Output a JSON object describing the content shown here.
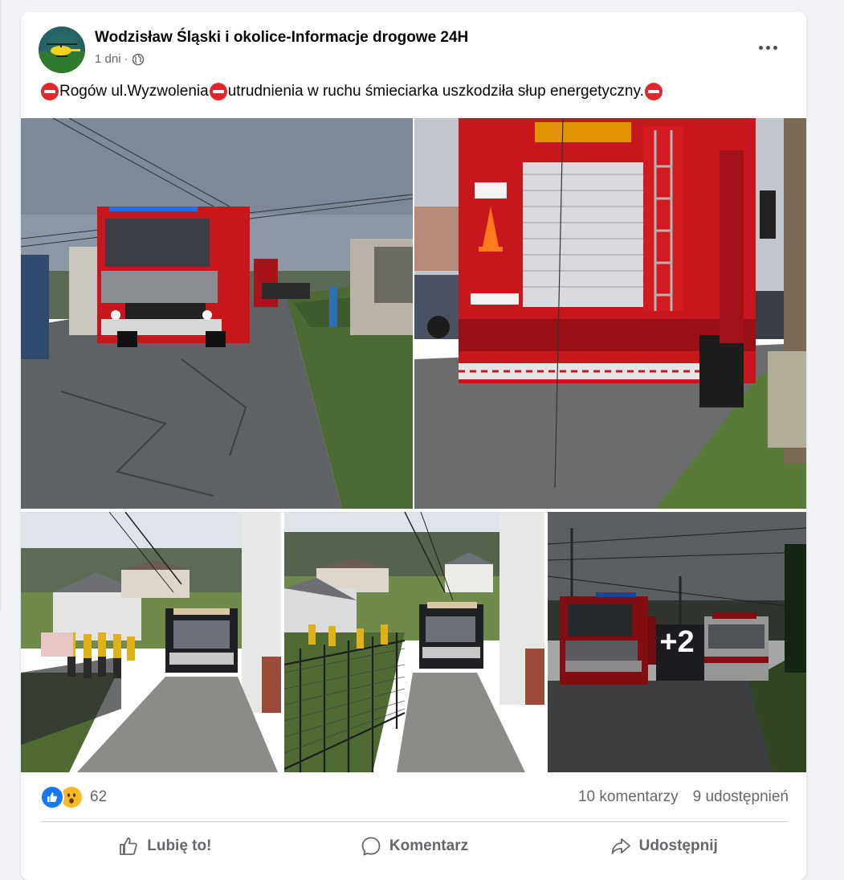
{
  "post": {
    "page_name": "Wodzisław Śląski i okolice-Informacje drogowe 24H",
    "time": "1 dni",
    "separator": "·",
    "privacy_icon": "globe-icon",
    "text_parts": [
      "Rogów ul.Wyzwolenia",
      " utrudnienia w ruchu śmieciarka uszkodziła słup energetyczny."
    ],
    "emoji_icon": "no-entry-emoji"
  },
  "photos": {
    "more_label": "+2"
  },
  "stats": {
    "reaction_icons": [
      "like-reaction-icon",
      "wow-reaction-icon"
    ],
    "reaction_count": "62",
    "comments": "10 komentarzy",
    "shares": "9 udostępnień"
  },
  "actions": {
    "like": "Lubię to!",
    "comment": "Komentarz",
    "share": "Udostępnij"
  },
  "colors": {
    "brand_blue": "#1877f2",
    "text_primary": "#050505",
    "text_secondary": "#65676b",
    "fire_truck_red": "#c8161d"
  }
}
